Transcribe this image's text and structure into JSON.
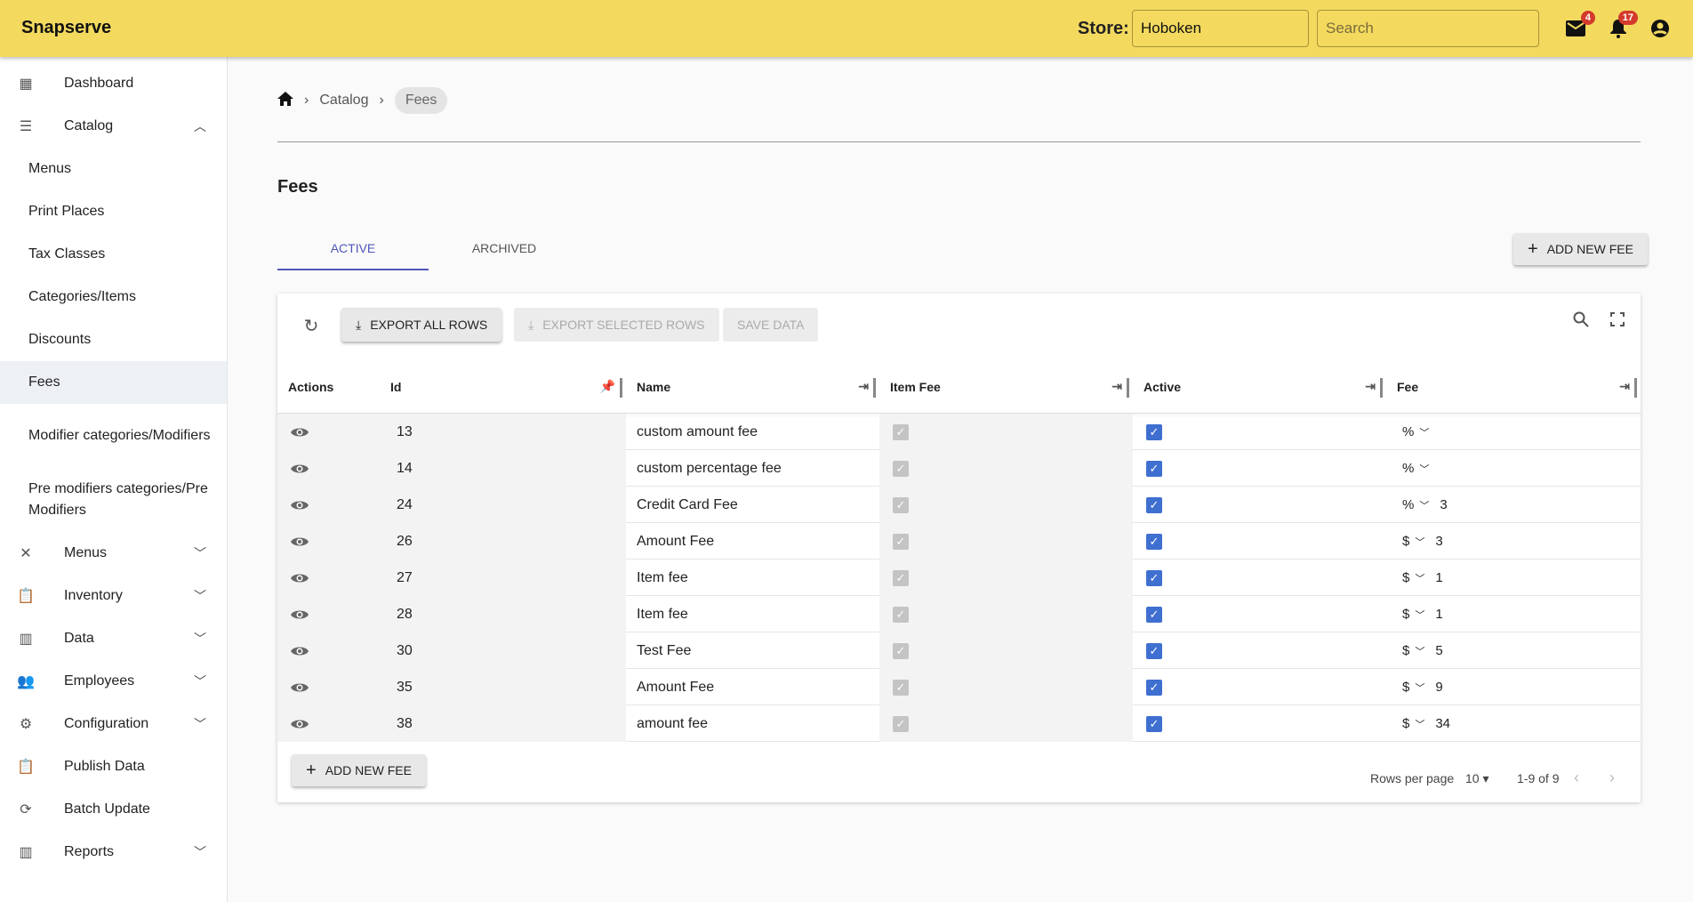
{
  "header": {
    "brand": "Snapserve",
    "store_label": "Store:",
    "store_value": "Hoboken",
    "search_placeholder": "Search",
    "mail_count": "4",
    "notif_count": "17"
  },
  "sidebar": {
    "items": [
      {
        "label": "Dashboard",
        "icon": "dashboard-icon",
        "type": "main"
      },
      {
        "label": "Catalog",
        "icon": "catalog-icon",
        "type": "main",
        "chevron": "up"
      },
      {
        "label": "Menus",
        "type": "sub"
      },
      {
        "label": "Print Places",
        "type": "sub"
      },
      {
        "label": "Tax Classes",
        "type": "sub"
      },
      {
        "label": "Categories/Items",
        "type": "sub"
      },
      {
        "label": "Discounts",
        "type": "sub"
      },
      {
        "label": "Fees",
        "type": "sub",
        "selected": true
      },
      {
        "label": "Modifier categories/Modifiers",
        "type": "sub2"
      },
      {
        "label": "Pre modifiers categories/Pre Modifiers",
        "type": "sub2"
      },
      {
        "label": "Menus",
        "icon": "utensils-icon",
        "type": "main",
        "chevron": "down"
      },
      {
        "label": "Inventory",
        "icon": "clipboard-icon",
        "type": "main",
        "chevron": "down"
      },
      {
        "label": "Data",
        "icon": "bar-chart-icon",
        "type": "main",
        "chevron": "down"
      },
      {
        "label": "Employees",
        "icon": "people-icon",
        "type": "main",
        "chevron": "down"
      },
      {
        "label": "Configuration",
        "icon": "gear-icon",
        "type": "main",
        "chevron": "down"
      },
      {
        "label": "Publish Data",
        "icon": "clipboard-icon",
        "type": "main"
      },
      {
        "label": "Batch Update",
        "icon": "sync-icon",
        "type": "main"
      },
      {
        "label": "Reports",
        "icon": "bar-chart-icon",
        "type": "main",
        "chevron": "down"
      }
    ]
  },
  "breadcrumb": [
    "Catalog",
    "Fees"
  ],
  "page_title": "Fees",
  "tabs": [
    {
      "label": "ACTIVE",
      "active": true
    },
    {
      "label": "ARCHIVED",
      "active": false
    }
  ],
  "add_new_fee": "ADD NEW FEE",
  "toolbar": {
    "export_all": "EXPORT ALL ROWS",
    "export_selected": "EXPORT SELECTED ROWS",
    "save": "SAVE DATA"
  },
  "columns": [
    "Actions",
    "Id",
    "Name",
    "Item Fee",
    "Active",
    "Fee"
  ],
  "rows": [
    {
      "id": "13",
      "name": "custom amount fee",
      "item_fee": true,
      "active": true,
      "fee_type": "%",
      "fee": ""
    },
    {
      "id": "14",
      "name": "custom percentage fee",
      "item_fee": true,
      "active": true,
      "fee_type": "%",
      "fee": ""
    },
    {
      "id": "24",
      "name": "Credit Card Fee",
      "item_fee": true,
      "active": true,
      "fee_type": "%",
      "fee": "3"
    },
    {
      "id": "26",
      "name": "Amount Fee",
      "item_fee": true,
      "active": true,
      "fee_type": "$",
      "fee": "3"
    },
    {
      "id": "27",
      "name": "Item fee",
      "item_fee": true,
      "active": true,
      "fee_type": "$",
      "fee": "1"
    },
    {
      "id": "28",
      "name": "Item fee",
      "item_fee": true,
      "active": true,
      "fee_type": "$",
      "fee": "1"
    },
    {
      "id": "30",
      "name": "Test Fee",
      "item_fee": true,
      "active": true,
      "fee_type": "$",
      "fee": "5"
    },
    {
      "id": "35",
      "name": "Amount Fee",
      "item_fee": true,
      "active": true,
      "fee_type": "$",
      "fee": "9"
    },
    {
      "id": "38",
      "name": "amount fee",
      "item_fee": true,
      "active": true,
      "fee_type": "$",
      "fee": "34"
    }
  ],
  "footer": {
    "rows_per_page_label": "Rows per page",
    "rows_per_page": "10",
    "range": "1-9 of 9"
  },
  "colors": {
    "topbar": "#f3da5f",
    "accent": "#5056b8",
    "checkbox": "#3f6fd0",
    "badge": "#d33a2c"
  }
}
